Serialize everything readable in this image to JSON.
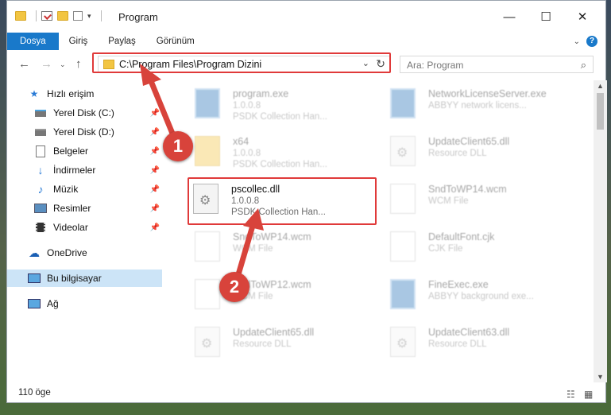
{
  "window": {
    "title": "Program",
    "buttons": {
      "minimize": "—",
      "maximize": "☐",
      "close": "✕"
    }
  },
  "ribbon": {
    "tabs": [
      "Dosya",
      "Giriş",
      "Paylaş",
      "Görünüm"
    ]
  },
  "address": {
    "path": "C:\\Program Files\\Program Dizini",
    "search_placeholder": "Ara: Program"
  },
  "sidebar": {
    "items": [
      {
        "label": "Hızlı erişim",
        "icon": "star-icon"
      },
      {
        "label": "Yerel Disk (C:)",
        "icon": "drive-icon"
      },
      {
        "label": "Yerel Disk (D:)",
        "icon": "drive-icon"
      },
      {
        "label": "Belgeler",
        "icon": "documents-icon"
      },
      {
        "label": "İndirmeler",
        "icon": "download-icon"
      },
      {
        "label": "Müzik",
        "icon": "music-icon"
      },
      {
        "label": "Resimler",
        "icon": "pictures-icon"
      },
      {
        "label": "Videolar",
        "icon": "videos-icon"
      },
      {
        "label": "OneDrive",
        "icon": "cloud-icon"
      },
      {
        "label": "Bu bilgisayar",
        "icon": "computer-icon"
      },
      {
        "label": "Ağ",
        "icon": "network-icon"
      }
    ]
  },
  "files": [
    {
      "name": "program.exe",
      "line1": "1.0.0.8",
      "line2": "PSDK Collection Han...",
      "type": "exe"
    },
    {
      "name": "NetworkLicenseServer.exe",
      "line1": "ABBYY network licens...",
      "line2": "",
      "type": "exe"
    },
    {
      "name": "x64",
      "line1": "1.0.0.8",
      "line2": "PSDK Collection Han...",
      "type": "folder"
    },
    {
      "name": "UpdateClient65.dll",
      "line1": "Resource DLL",
      "line2": "",
      "type": "dll"
    },
    {
      "name": "pscollec.dll",
      "line1": "1.0.0.8",
      "line2": "PSDK Collection Han...",
      "type": "dll"
    },
    {
      "name": "SndToWP14.wcm",
      "line1": "WCM File",
      "line2": "",
      "type": "doc"
    },
    {
      "name": "SndToWP14.wcm",
      "line1": "WCM File",
      "line2": "",
      "type": "doc"
    },
    {
      "name": "DefaultFont.cjk",
      "line1": "CJK File",
      "line2": "",
      "type": "doc"
    },
    {
      "name": "SndToWP12.wcm",
      "line1": "WCM File",
      "line2": "",
      "type": "doc"
    },
    {
      "name": "FineExec.exe",
      "line1": "ABBYY background exe...",
      "line2": "",
      "type": "exe"
    },
    {
      "name": "UpdateClient65.dll",
      "line1": "Resource DLL",
      "line2": "",
      "type": "dll"
    },
    {
      "name": "UpdateClient63.dll",
      "line1": "Resource DLL",
      "line2": "",
      "type": "dll"
    }
  ],
  "status": {
    "count": "110 öge"
  },
  "callouts": [
    "1",
    "2"
  ],
  "colors": {
    "accent": "#1979ca",
    "highlight": "#e03a3a",
    "callout": "#d8433b",
    "selected": "#cce4f7"
  }
}
